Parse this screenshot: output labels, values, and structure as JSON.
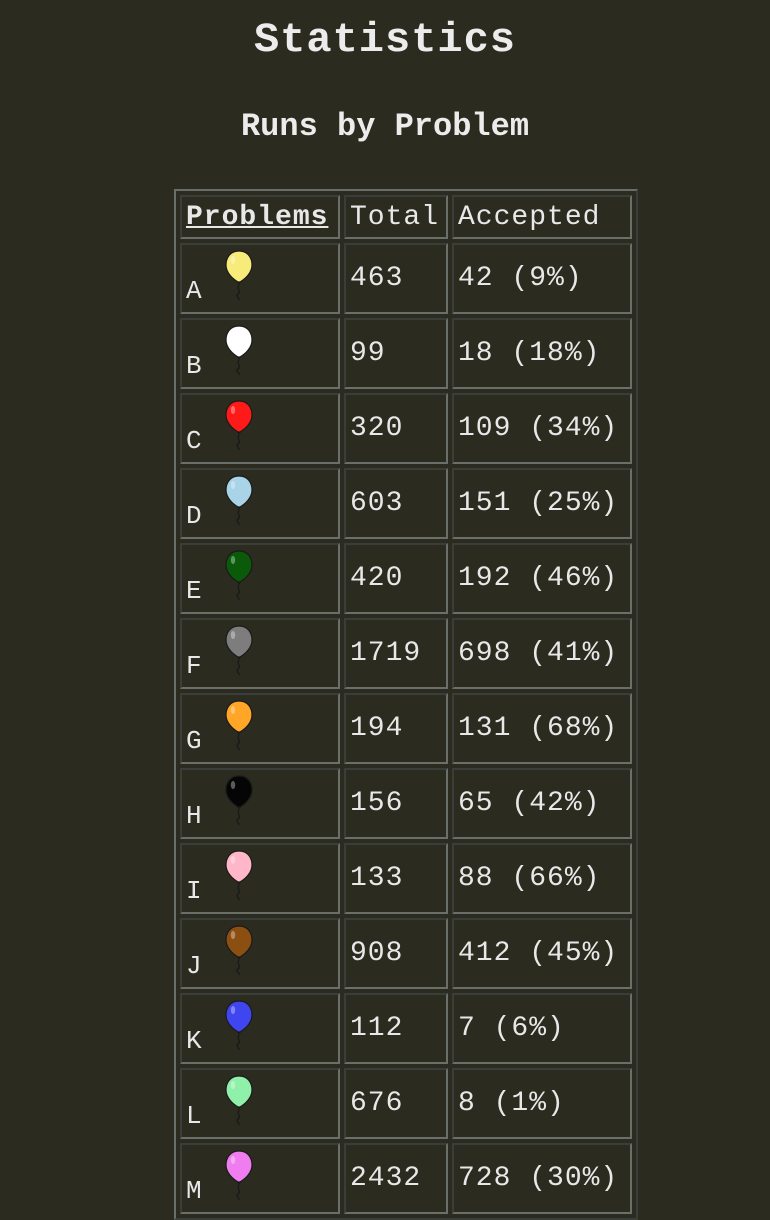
{
  "page": {
    "title": "Statistics",
    "section_title": "Runs by Problem"
  },
  "table": {
    "headers": {
      "problems": "Problems",
      "total": "Total",
      "accepted": "Accepted"
    },
    "rows": [
      {
        "letter": "A",
        "balloon_color": "#f7ec7a",
        "balloon_icon": "balloon-icon",
        "total": "463",
        "accepted": "42 (9%)"
      },
      {
        "letter": "B",
        "balloon_color": "#ffffff",
        "balloon_icon": "balloon-icon",
        "total": "99",
        "accepted": "18 (18%)"
      },
      {
        "letter": "C",
        "balloon_color": "#ff1a1a",
        "balloon_icon": "balloon-icon",
        "total": "320",
        "accepted": "109 (34%)"
      },
      {
        "letter": "D",
        "balloon_color": "#a9d3e6",
        "balloon_icon": "balloon-icon",
        "total": "603",
        "accepted": "151 (25%)"
      },
      {
        "letter": "E",
        "balloon_color": "#0a5a0a",
        "balloon_icon": "balloon-icon",
        "total": "420",
        "accepted": "192 (46%)"
      },
      {
        "letter": "F",
        "balloon_color": "#7d7d7d",
        "balloon_icon": "balloon-icon",
        "total": "1719",
        "accepted": "698 (41%)"
      },
      {
        "letter": "G",
        "balloon_color": "#ffa626",
        "balloon_icon": "balloon-icon",
        "total": "194",
        "accepted": "131 (68%)"
      },
      {
        "letter": "H",
        "balloon_color": "#050505",
        "balloon_icon": "balloon-icon",
        "total": "156",
        "accepted": "65 (42%)"
      },
      {
        "letter": "I",
        "balloon_color": "#ffb6c8",
        "balloon_icon": "balloon-icon",
        "total": "133",
        "accepted": "88 (66%)"
      },
      {
        "letter": "J",
        "balloon_color": "#8b4f12",
        "balloon_icon": "balloon-icon",
        "total": "908",
        "accepted": "412 (45%)"
      },
      {
        "letter": "K",
        "balloon_color": "#3f46f0",
        "balloon_icon": "balloon-icon",
        "total": "112",
        "accepted": "7 (6%)"
      },
      {
        "letter": "L",
        "balloon_color": "#8ff0a9",
        "balloon_icon": "balloon-icon",
        "total": "676",
        "accepted": "8 (1%)"
      },
      {
        "letter": "M",
        "balloon_color": "#f07df0",
        "balloon_icon": "balloon-icon",
        "total": "2432",
        "accepted": "728 (30%)"
      }
    ]
  }
}
